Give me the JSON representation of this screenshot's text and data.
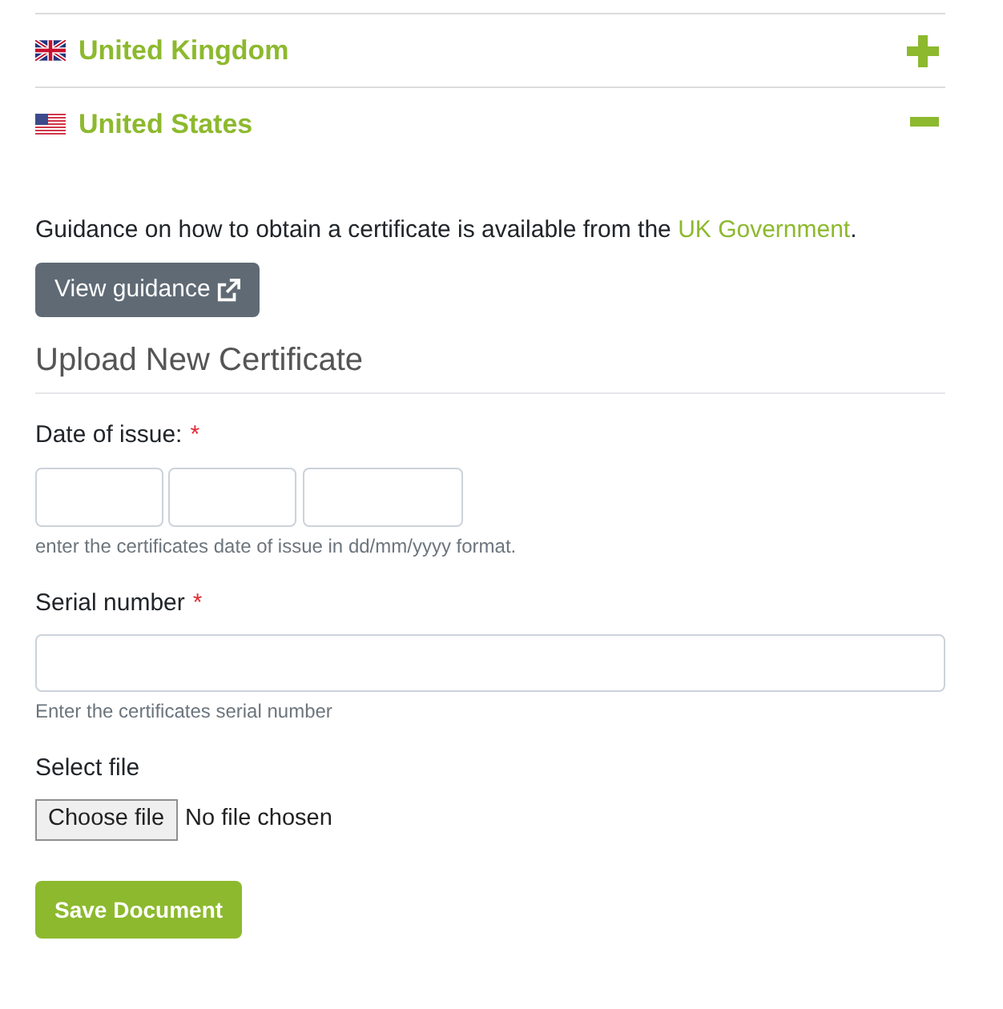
{
  "accordion": [
    {
      "kind": "uk",
      "title": "United Kingdom",
      "expanded": false
    },
    {
      "kind": "us",
      "title": "United States",
      "expanded": true
    }
  ],
  "panel": {
    "guidance": {
      "text": "Guidance on how to obtain a certificate is available from the ",
      "link": "UK Government",
      "after": "."
    },
    "guidance_button": "View guidance",
    "heading": "Upload New Certificate",
    "fields": [
      {
        "kind": "date",
        "label": "Date of issue:",
        "required_mark": "*",
        "hint": "enter the certificates date of issue in dd/mm/yyyy format."
      },
      {
        "kind": "text",
        "label": "Serial number",
        "required_mark": "*",
        "hint": "Enter the certificates serial number"
      },
      {
        "kind": "file",
        "label": "Select file",
        "button": "Choose file",
        "status": "No file chosen"
      }
    ],
    "submit": "Save Document"
  }
}
